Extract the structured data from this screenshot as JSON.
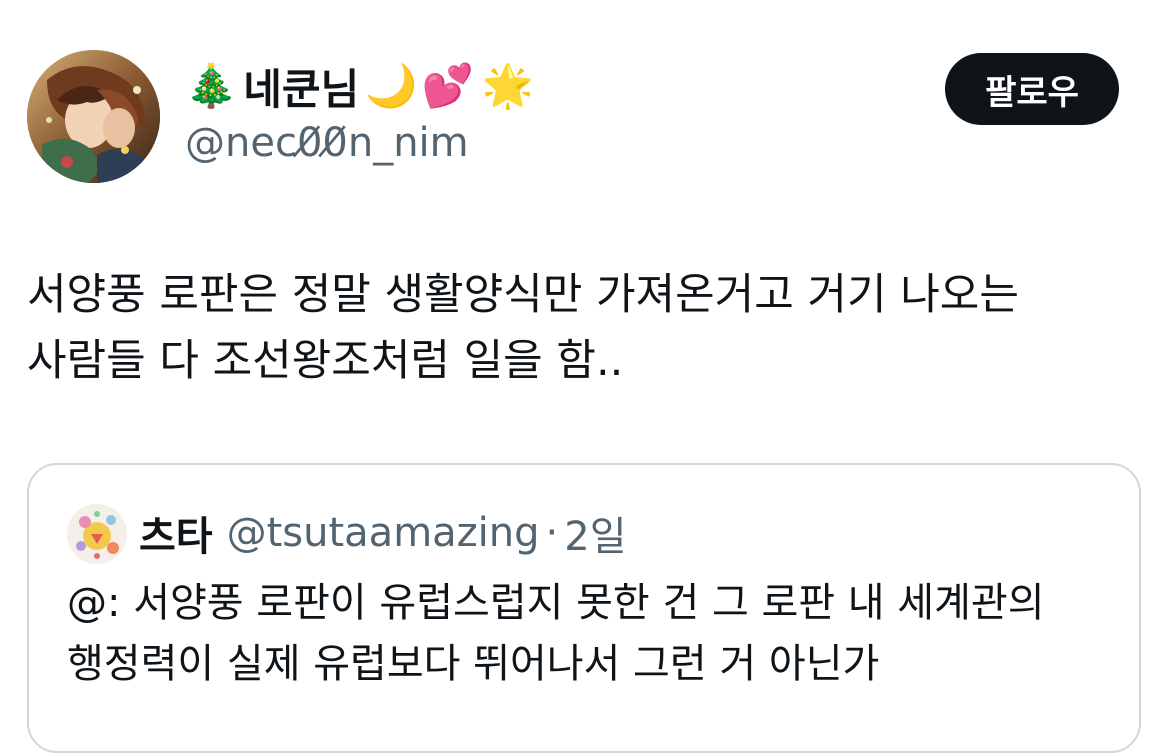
{
  "author": {
    "display_name": "네쿤님",
    "emoji_1": "🎄",
    "emoji_2": "🌙",
    "emoji_3": "💕",
    "emoji_4": "🌟",
    "handle": "@nec0̸0̸n_nim"
  },
  "follow_button": {
    "label": "팔로우"
  },
  "tweet": {
    "lines": [
      "서양풍 로판은 정말 생활양식만 가져온거고 거기 나오는",
      "사람들 다 조선왕조처럼 일을 함.."
    ]
  },
  "quote": {
    "display_name": "츠타",
    "handle": "@tsutaamazing",
    "separator": "·",
    "time": "2일",
    "lines": [
      "@: 서양풍 로판이 유럽스럽지 못한 건 그 로판 내 세계관의",
      "행정력이 실제 유럽보다 뛰어나서 그런 거 아닌가"
    ]
  },
  "colors": {
    "text_primary": "#0f1419",
    "text_secondary": "#536471",
    "border": "#cfd9de",
    "button_bg": "#0f1419"
  }
}
